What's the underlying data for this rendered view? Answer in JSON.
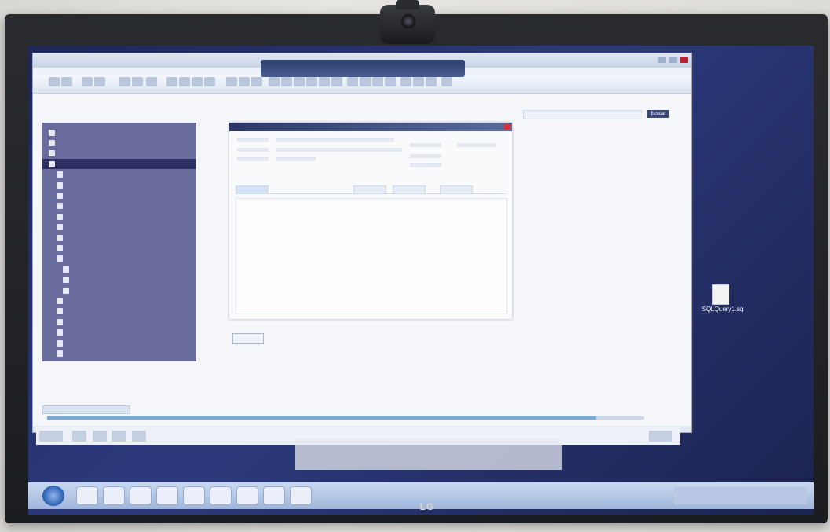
{
  "monitor": {
    "brand": "LG"
  },
  "app": {
    "sidebar_items": [
      {
        "level": 0,
        "head": false
      },
      {
        "level": 0,
        "head": false
      },
      {
        "level": 0,
        "head": false
      },
      {
        "level": 0,
        "head": true
      },
      {
        "level": 1
      },
      {
        "level": 1
      },
      {
        "level": 1
      },
      {
        "level": 1
      },
      {
        "level": 1
      },
      {
        "level": 1
      },
      {
        "level": 1
      },
      {
        "level": 1
      },
      {
        "level": 1
      },
      {
        "level": 2
      },
      {
        "level": 2
      },
      {
        "level": 2
      },
      {
        "level": 1
      },
      {
        "level": 1
      },
      {
        "level": 1
      },
      {
        "level": 1
      },
      {
        "level": 1
      },
      {
        "level": 1
      }
    ],
    "search_button": "Buscar",
    "progress": 0.92
  },
  "desktop": {
    "file_label": "SQLQuery1.sql"
  },
  "colors": {
    "sidebar": "#6b6c9e",
    "desktop": "#2c3a7c",
    "taskbar": "#c9d9f0"
  }
}
